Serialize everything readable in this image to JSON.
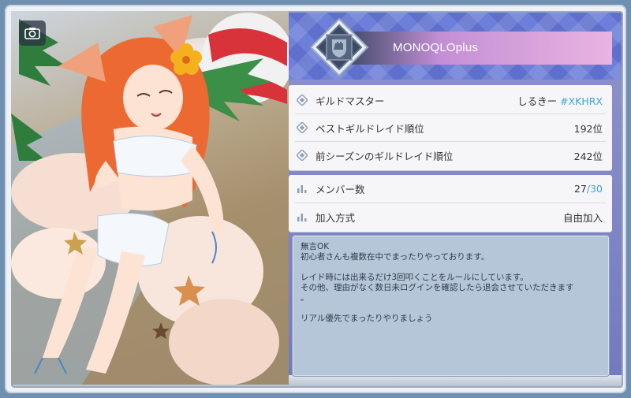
{
  "guild": {
    "name": "MONOQLOplus"
  },
  "info_card": {
    "rows": [
      {
        "label": "ギルドマスター",
        "value_name": "しるきー",
        "value_tag": "#XKHRX"
      },
      {
        "label": "ベストギルドレイド順位",
        "value": "192位"
      },
      {
        "label": "前シーズンのギルドレイド順位",
        "value": "242位"
      }
    ]
  },
  "member_card": {
    "members_label": "メンバー数",
    "members_current": "27",
    "members_sep": "/",
    "members_max": "30",
    "join_label": "加入方式",
    "join_value": "自由加入"
  },
  "description": {
    "text": "無言OK\n初心者さんも複数在中でまったりやっております。\n\nレイド時には出来るだけ3回叩くことをルールにしています。\nその他、理由がなく数日未ログインを確認したら退会させていただきます\n。\n\nリアル優先でまったりやりましょう"
  },
  "colors": {
    "accent": "#3ea3d9",
    "card_bg": "#f6f6f8",
    "desc_bg": "#b5c6d9"
  },
  "icons": {
    "camera": "camera-icon",
    "diamond": "diamond-bullet-icon",
    "bars": "bar-chart-icon",
    "emblem": "guild-emblem-icon"
  }
}
